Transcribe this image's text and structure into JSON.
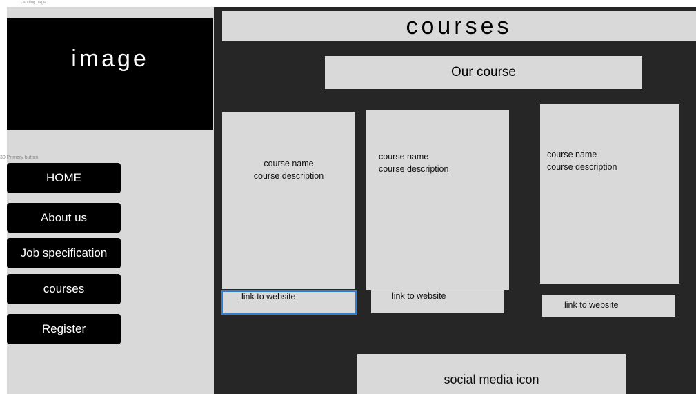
{
  "frame_label": "Landing page",
  "hero": {
    "label": "image"
  },
  "variant_label": "30 Primary button",
  "nav": [
    "HOME",
    "About us",
    "Job specification",
    "courses",
    "Register"
  ],
  "header": {
    "title": "courses",
    "subtitle": "Our course"
  },
  "cards": [
    {
      "name": "course name",
      "description": "course description",
      "link": "link to website"
    },
    {
      "name": "course name",
      "description": "course description",
      "link": "link to website"
    },
    {
      "name": "course name",
      "description": "course description",
      "link": "link to website"
    }
  ],
  "footer": {
    "social": "social media icon"
  },
  "colors": {
    "canvas": "#262626",
    "panel": "#d9d9d9",
    "button": "#000000",
    "focus": "#2f7fd6"
  }
}
